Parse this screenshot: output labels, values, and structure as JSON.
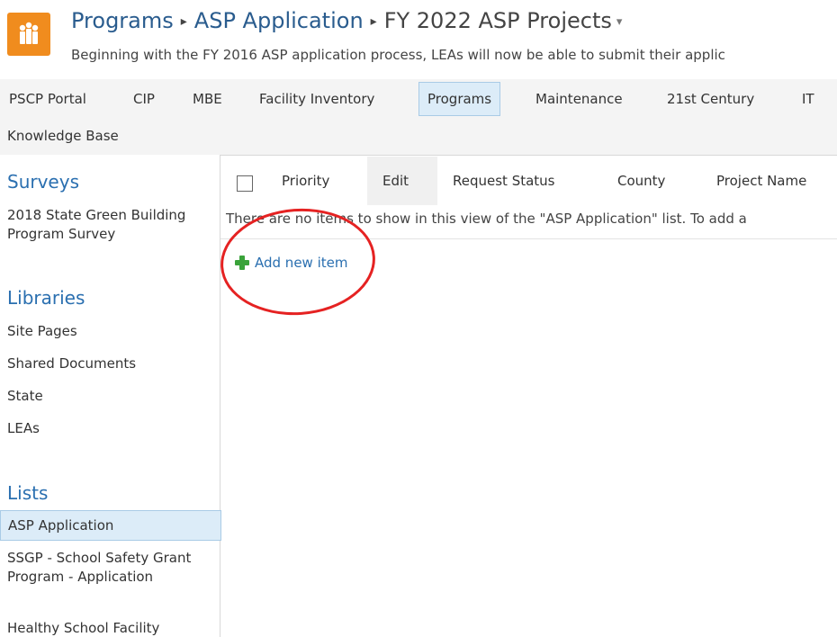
{
  "header": {
    "breadcrumb": [
      "Programs",
      "ASP Application",
      "FY 2022 ASP Projects"
    ],
    "separator": "▸",
    "dropdown_glyph": "▾",
    "subtitle": "Beginning with the FY 2016 ASP application process, LEAs will now be able to submit their applic",
    "logo_icon": "people-icon",
    "logo_color": "#f08c1e"
  },
  "topnav": {
    "items": [
      "PSCP Portal",
      "CIP",
      "MBE",
      "Facility Inventory",
      "Programs",
      "Maintenance",
      "21st Century",
      "IT"
    ],
    "row2": "Knowledge Base",
    "selected": "Programs"
  },
  "leftnav": {
    "surveys_heading": "Surveys",
    "survey_item": "2018 State Green Building Program Survey",
    "libraries_heading": "Libraries",
    "libraries": [
      "Site Pages",
      "Shared Documents",
      "State",
      "LEAs"
    ],
    "lists_heading": "Lists",
    "lists": [
      "ASP Application",
      "SSGP - School Safety Grant Program - Application",
      "Healthy School Facility"
    ]
  },
  "list": {
    "columns": [
      "Priority",
      "Edit",
      "Request Status",
      "County",
      "Project Name"
    ],
    "empty_message": "There are no items to show in this view of the \"ASP Application\" list. To add a",
    "add_new_item": "Add new item"
  },
  "colors": {
    "accent": "#2a6fb0",
    "selected_bg": "#dcecf8",
    "annotation": "#e52222",
    "plus": "#3aa33a"
  }
}
